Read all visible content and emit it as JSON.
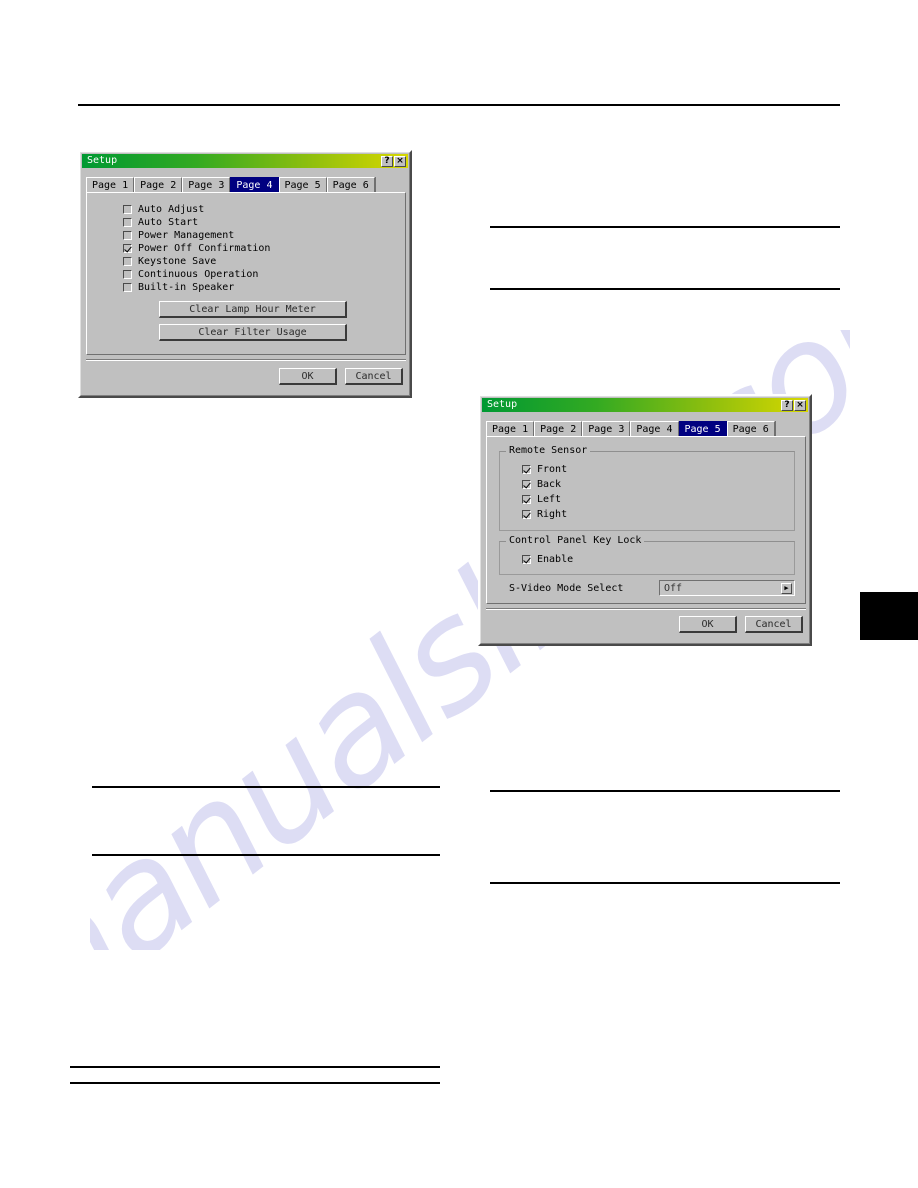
{
  "document": {
    "watermark_text": "manualslive.com"
  },
  "dialog1": {
    "title": "Setup",
    "help_button": "?",
    "close_button": "×",
    "tabs": [
      {
        "label": "Page 1",
        "selected": false
      },
      {
        "label": "Page 2",
        "selected": false
      },
      {
        "label": "Page 3",
        "selected": false
      },
      {
        "label": "Page 4",
        "selected": true
      },
      {
        "label": "Page 5",
        "selected": false
      },
      {
        "label": "Page 6",
        "selected": false
      }
    ],
    "checkboxes": [
      {
        "label": "Auto Adjust",
        "checked": false
      },
      {
        "label": "Auto Start",
        "checked": false
      },
      {
        "label": "Power Management",
        "checked": false
      },
      {
        "label": "Power Off Confirmation",
        "checked": true
      },
      {
        "label": "Keystone Save",
        "checked": false
      },
      {
        "label": "Continuous Operation",
        "checked": false
      },
      {
        "label": "Built-in Speaker",
        "checked": false
      }
    ],
    "action_buttons": [
      {
        "label": "Clear Lamp Hour Meter"
      },
      {
        "label": "Clear Filter Usage"
      }
    ],
    "ok_label": "OK",
    "cancel_label": "Cancel"
  },
  "dialog2": {
    "title": "Setup",
    "help_button": "?",
    "close_button": "×",
    "tabs": [
      {
        "label": "Page 1",
        "selected": false
      },
      {
        "label": "Page 2",
        "selected": false
      },
      {
        "label": "Page 3",
        "selected": false
      },
      {
        "label": "Page 4",
        "selected": false
      },
      {
        "label": "Page 5",
        "selected": true
      },
      {
        "label": "Page 6",
        "selected": false
      }
    ],
    "remote_sensor": {
      "title": "Remote Sensor",
      "checkboxes": [
        {
          "label": "Front",
          "checked": true
        },
        {
          "label": "Back",
          "checked": true
        },
        {
          "label": "Left",
          "checked": true
        },
        {
          "label": "Right",
          "checked": true
        }
      ]
    },
    "key_lock": {
      "title": "Control Panel Key Lock",
      "checkboxes": [
        {
          "label": "Enable",
          "checked": true
        }
      ]
    },
    "svideo": {
      "label": "S-Video Mode Select",
      "value": "Off",
      "arrow": "▶"
    },
    "ok_label": "OK",
    "cancel_label": "Cancel"
  },
  "colors": {
    "title_start": "#009933",
    "title_end": "#d8d800",
    "tab_selected": "#000080",
    "dialog_face": "#c0c0c0",
    "watermark": "#c9c9ee"
  }
}
